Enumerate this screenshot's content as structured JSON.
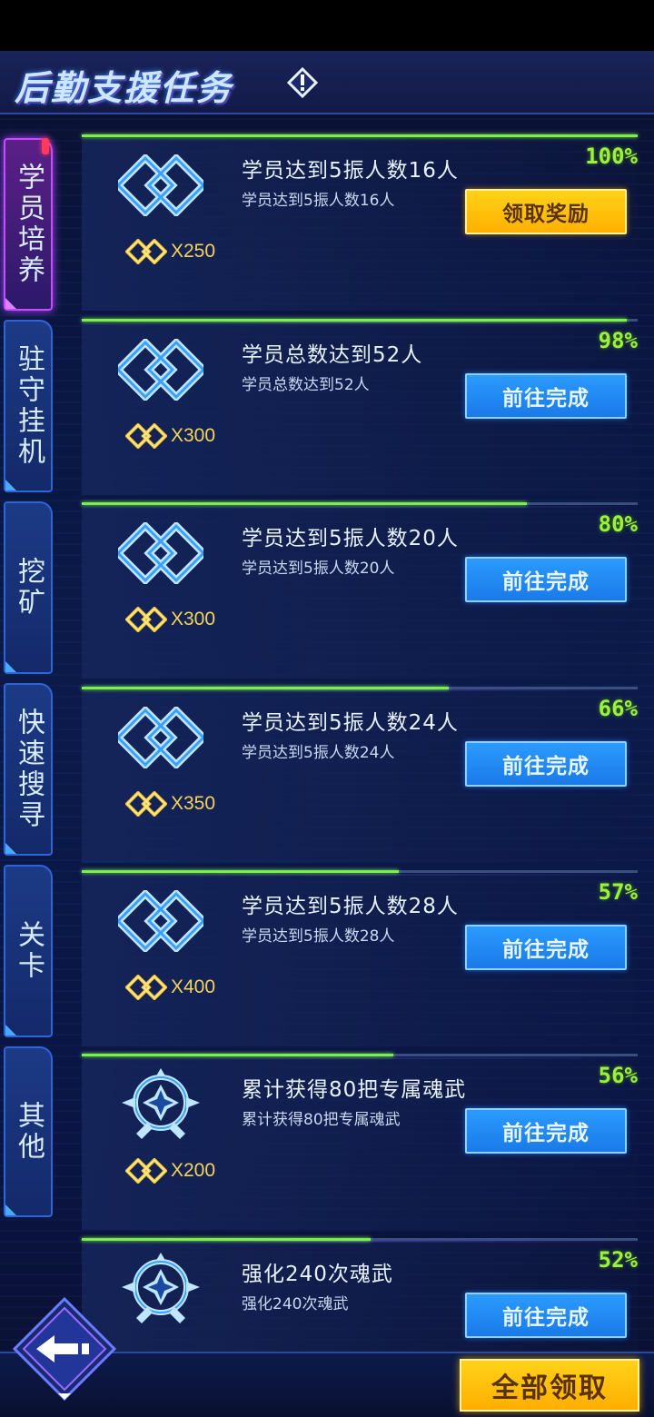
{
  "header": {
    "title": "后勤支援任务",
    "info_icon": "info-diamond-icon"
  },
  "sidebar": {
    "tabs": [
      {
        "label": "学员培养",
        "active": true,
        "alert": true
      },
      {
        "label": "驻守挂机",
        "active": false
      },
      {
        "label": "挖矿",
        "active": false
      },
      {
        "label": "快速搜寻",
        "active": false
      },
      {
        "label": "关卡",
        "active": false
      },
      {
        "label": "其他",
        "active": false
      }
    ]
  },
  "tasks": [
    {
      "title": "学员达到5振人数16人",
      "subtitle": "学员达到5振人数16人",
      "percent": "100%",
      "progress": 1.0,
      "reward": "X250",
      "button": "领取奖励",
      "button_type": "claim",
      "icon": "double-diamond-icon"
    },
    {
      "title": "学员总数达到52人",
      "subtitle": "学员总数达到52人",
      "percent": "98%",
      "progress": 0.98,
      "reward": "X300",
      "button": "前往完成",
      "button_type": "go",
      "icon": "double-diamond-icon"
    },
    {
      "title": "学员达到5振人数20人",
      "subtitle": "学员达到5振人数20人",
      "percent": "80%",
      "progress": 0.8,
      "reward": "X300",
      "button": "前往完成",
      "button_type": "go",
      "icon": "double-diamond-icon"
    },
    {
      "title": "学员达到5振人数24人",
      "subtitle": "学员达到5振人数24人",
      "percent": "66%",
      "progress": 0.66,
      "reward": "X350",
      "button": "前往完成",
      "button_type": "go",
      "icon": "double-diamond-icon"
    },
    {
      "title": "学员达到5振人数28人",
      "subtitle": "学员达到5振人数28人",
      "percent": "57%",
      "progress": 0.57,
      "reward": "X400",
      "button": "前往完成",
      "button_type": "go",
      "icon": "double-diamond-icon"
    },
    {
      "title": "累计获得80把专属魂武",
      "subtitle": "累计获得80把专属魂武",
      "percent": "56%",
      "progress": 0.56,
      "reward": "X200",
      "button": "前往完成",
      "button_type": "go",
      "icon": "soul-weapon-icon"
    },
    {
      "title": "强化240次魂武",
      "subtitle": "强化240次魂武",
      "percent": "52%",
      "progress": 0.52,
      "reward": "",
      "button": "前往完成",
      "button_type": "go",
      "icon": "soul-weapon-icon"
    }
  ],
  "footer": {
    "claim_all": "全部领取",
    "back_icon": "back-arrow-icon"
  },
  "colors": {
    "progress": "#7cf04a",
    "go_button": "#1a7ae8",
    "claim_button": "#ffc000",
    "reward_text": "#f5d45a"
  }
}
